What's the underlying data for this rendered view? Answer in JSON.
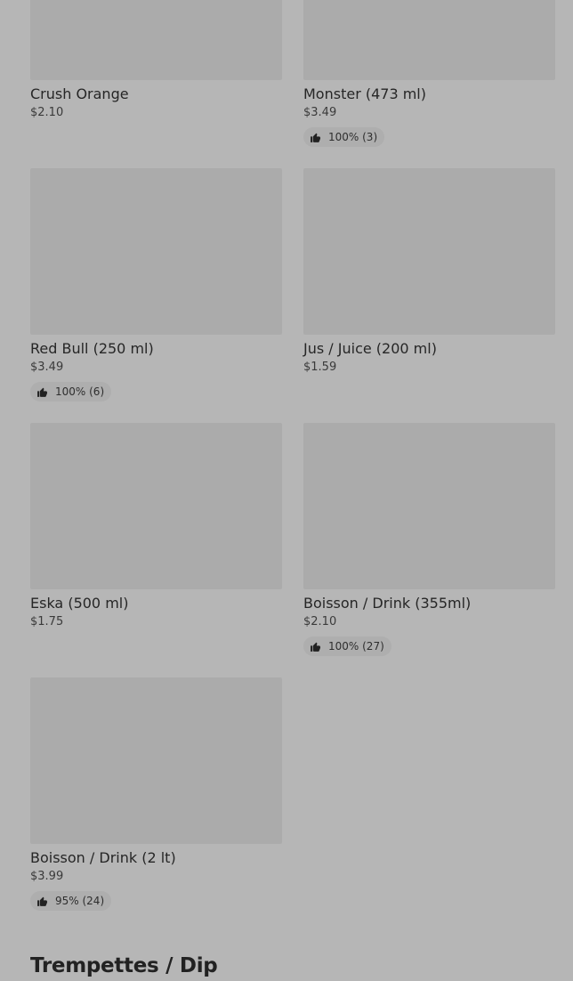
{
  "products": [
    {
      "name": "Crush Orange",
      "price": "$2.10",
      "rating": ""
    },
    {
      "name": "Monster (473 ml)",
      "price": "$3.49",
      "rating": "100% (3)"
    },
    {
      "name": "Red Bull (250 ml)",
      "price": "$3.49",
      "rating": "100% (6)"
    },
    {
      "name": "Jus / Juice (200 ml)",
      "price": "$1.59",
      "rating": ""
    },
    {
      "name": "Eska (500 ml)",
      "price": "$1.75",
      "rating": ""
    },
    {
      "name": "Boisson / Drink (355ml)",
      "price": "$2.10",
      "rating": "100% (27)"
    },
    {
      "name": "Boisson / Drink (2 lt)",
      "price": "$3.99",
      "rating": "95% (24)"
    }
  ],
  "next_section": {
    "title": "Trempettes / Dip"
  },
  "icons": {
    "rating": "thumbs-up-icon"
  },
  "colors": {
    "background": "#b6b6b6",
    "image_placeholder": "#ababab",
    "rating_badge": "#aeaeae",
    "text": "#262626"
  }
}
